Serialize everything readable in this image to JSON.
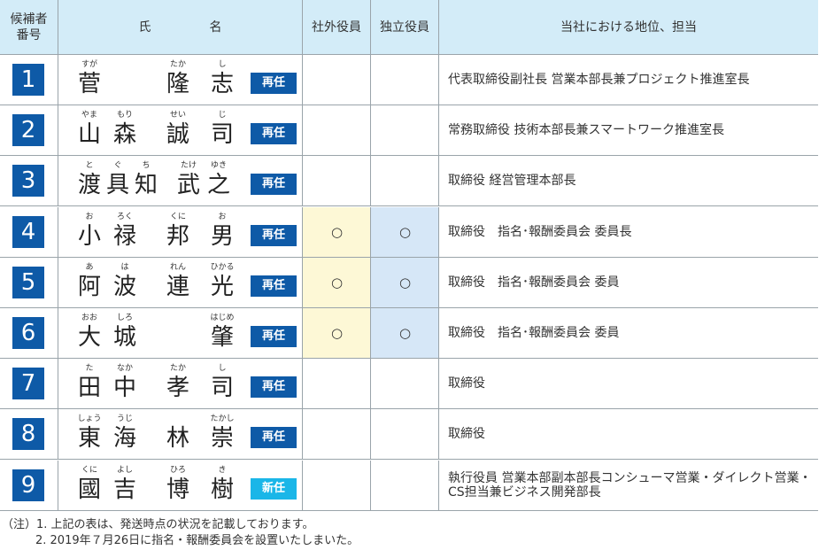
{
  "header": {
    "candidate_no": "候補者\n番号",
    "name_1": "氏",
    "name_2": "名",
    "outside": "社外役員",
    "independent": "独立役員",
    "position": "当社における地位、担当"
  },
  "colors": {
    "number_bg": "#0e5aa7",
    "badge_reappoint": "#0e5aa7",
    "badge_new": "#1ab6e8",
    "outside_bg": "#fdf8d6",
    "independent_bg": "#d6e7f7",
    "header_bg": "#d3ecf8"
  },
  "rows": [
    {
      "no": "1",
      "chars": [
        {
          "c": "菅",
          "r": "すが"
        },
        {
          "c": "",
          "r": ""
        },
        {
          "c": "隆",
          "r": "たか"
        },
        {
          "c": "志",
          "r": "し"
        }
      ],
      "badge": "再任",
      "badge_type": "re",
      "outside": "",
      "independent": "",
      "position": "代表取締役副社長 営業本部長兼プロジェクト推進室長"
    },
    {
      "no": "2",
      "chars": [
        {
          "c": "山",
          "r": "やま"
        },
        {
          "c": "森",
          "r": "もり"
        },
        {
          "c": "誠",
          "r": "せい"
        },
        {
          "c": "司",
          "r": "じ"
        }
      ],
      "badge": "再任",
      "badge_type": "re",
      "outside": "",
      "independent": "",
      "position": "常務取締役 技術本部長兼スマートワーク推進室長"
    },
    {
      "no": "3",
      "chars": [
        {
          "c": "渡",
          "r": "と"
        },
        {
          "c": "具",
          "r": "ぐ"
        },
        {
          "c": "知",
          "r": "ち"
        },
        {
          "c": "武",
          "r": "たけ"
        },
        {
          "c": "之",
          "r": "ゆき"
        }
      ],
      "badge": "再任",
      "badge_type": "re",
      "outside": "",
      "independent": "",
      "position": "取締役 経営管理本部長"
    },
    {
      "no": "4",
      "chars": [
        {
          "c": "小",
          "r": "お"
        },
        {
          "c": "禄",
          "r": "ろく"
        },
        {
          "c": "邦",
          "r": "くに"
        },
        {
          "c": "男",
          "r": "お"
        }
      ],
      "badge": "再任",
      "badge_type": "re",
      "outside": "○",
      "independent": "○",
      "position": "取締役　指名･報酬委員会 委員長"
    },
    {
      "no": "5",
      "chars": [
        {
          "c": "阿",
          "r": "あ"
        },
        {
          "c": "波",
          "r": "は"
        },
        {
          "c": "連",
          "r": "れん"
        },
        {
          "c": "光",
          "r": "ひかる"
        }
      ],
      "badge": "再任",
      "badge_type": "re",
      "outside": "○",
      "independent": "○",
      "position": "取締役　指名･報酬委員会 委員"
    },
    {
      "no": "6",
      "chars": [
        {
          "c": "大",
          "r": "おお"
        },
        {
          "c": "城",
          "r": "しろ"
        },
        {
          "c": "",
          "r": ""
        },
        {
          "c": "肇",
          "r": "はじめ"
        }
      ],
      "badge": "再任",
      "badge_type": "re",
      "outside": "○",
      "independent": "○",
      "position": "取締役　指名･報酬委員会 委員"
    },
    {
      "no": "7",
      "chars": [
        {
          "c": "田",
          "r": "た"
        },
        {
          "c": "中",
          "r": "なか"
        },
        {
          "c": "孝",
          "r": "たか"
        },
        {
          "c": "司",
          "r": "し"
        }
      ],
      "badge": "再任",
      "badge_type": "re",
      "outside": "",
      "independent": "",
      "position": "取締役"
    },
    {
      "no": "8",
      "chars": [
        {
          "c": "東",
          "r": "しょう"
        },
        {
          "c": "海",
          "r": "うじ"
        },
        {
          "c": "林",
          "r": ""
        },
        {
          "c": "崇",
          "r": "たかし"
        }
      ],
      "badge": "再任",
      "badge_type": "re",
      "outside": "",
      "independent": "",
      "position": "取締役"
    },
    {
      "no": "9",
      "chars": [
        {
          "c": "國",
          "r": "くに"
        },
        {
          "c": "吉",
          "r": "よし"
        },
        {
          "c": "博",
          "r": "ひろ"
        },
        {
          "c": "樹",
          "r": "き"
        }
      ],
      "badge": "新任",
      "badge_type": "new",
      "outside": "",
      "independent": "",
      "position": "執行役員 営業本部副本部長コンシューマ営業・ダイレクト営業・CS担当兼ビジネス開発部長"
    }
  ],
  "notes": [
    "（注）1.  上記の表は、発送時点の状況を記載しております。",
    "2.  2019年７月26日に指名・報酬委員会を設置いたしまいた。"
  ]
}
